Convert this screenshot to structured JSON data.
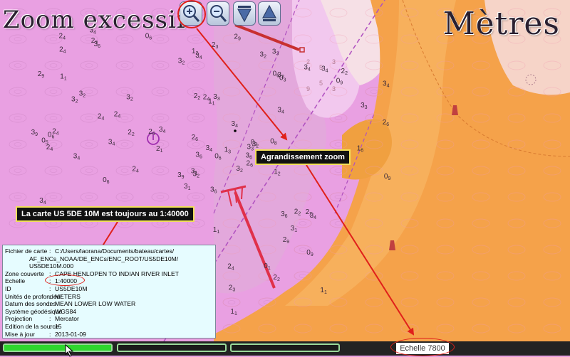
{
  "overlay": {
    "zoom_warning": "Zoom excessif",
    "units_label": "Mètres"
  },
  "toolbar": {
    "zoom_in_icon": "zoom-in-magnifier-icon",
    "zoom_out_icon": "zoom-out-magnifier-icon",
    "down_icon": "down-triangle-icon",
    "up_icon": "up-triangle-icon"
  },
  "callouts": {
    "zoom": "Agrandissement zoom",
    "scale": "La carte US 5DE 10M est toujours au 1:40000"
  },
  "chart_info": {
    "file_key": "Fichier de carte",
    "file_val": "C:/Users/laorana/Documents/bateau/cartes/",
    "file_cont1": "AF_ENCs_NOAA/DE_ENCs/ENC_ROOT/US5DE10M/",
    "file_cont2": "US5DE10M.000",
    "rows": [
      {
        "key": "Zone couverte",
        "val": "CAPE HENLOPEN TO INDIAN RIVER INLET"
      },
      {
        "key": "Echelle",
        "val": "1:40000"
      },
      {
        "key": "ID",
        "val": "US5DE10M"
      },
      {
        "key": "Unités de profondeur",
        "val": "METERS"
      },
      {
        "key": "Datum des sondes",
        "val": "MEAN LOWER LOW WATER"
      },
      {
        "key": "Système géodésique",
        "val": "WGS84"
      },
      {
        "key": "Projection",
        "val": "Mercator"
      },
      {
        "key": "Edition de la source",
        "val": "15"
      },
      {
        "key": "Mise à jour",
        "val": "2013-01-09"
      }
    ]
  },
  "map": {
    "soundings": [
      "3",
      "3",
      "3",
      "3",
      "3",
      "3",
      "3",
      "3",
      "3",
      "3",
      "3",
      "3",
      "3",
      "2",
      "3",
      "3",
      "2",
      "3",
      "3",
      "3",
      "3",
      "2",
      "3",
      "2",
      "3",
      "3",
      "3",
      "3",
      "2",
      "2",
      "2",
      "3",
      "2",
      "3",
      "3",
      "2",
      "3",
      "2",
      "3",
      "2",
      "2",
      "2",
      "2",
      "2",
      "2",
      "2",
      "2",
      "2",
      "3",
      "3",
      "3",
      "3",
      "3",
      "2",
      "2",
      "2",
      "2",
      "3",
      "2",
      "2",
      "1",
      "1",
      "1",
      "1",
      "1",
      "1",
      "0",
      "1",
      "0",
      "0",
      "0",
      "0",
      "0",
      "0",
      "0",
      "0",
      "0",
      "0",
      "0",
      "0",
      "0",
      "2",
      "1",
      "1",
      "3"
    ],
    "sounding_subs": [
      "6",
      "2",
      "2",
      "3",
      "3",
      "3",
      "2",
      "2",
      "6",
      "4",
      "4",
      "1",
      "4",
      "2",
      "4",
      "4",
      "4",
      "2",
      "4",
      "2",
      "4",
      "4",
      "6",
      "6",
      "1",
      "6",
      "2",
      "4",
      "2",
      "9",
      "6",
      "4",
      "9",
      "9",
      "6",
      "6",
      "3",
      "9",
      "1",
      "2",
      "3",
      "4",
      "4",
      "2",
      "3",
      "4",
      "4",
      "4",
      "4",
      "4",
      "2",
      "2",
      "4",
      "2",
      "2",
      "4",
      "4",
      "4",
      "6",
      "3",
      "3",
      "2",
      "6",
      "1",
      "1",
      "1",
      "1",
      "2",
      "8",
      "9",
      "6",
      "6",
      "6",
      "3",
      "6",
      "6",
      "9",
      "5",
      "9",
      "3",
      "9",
      "1",
      "1",
      "1",
      "9"
    ],
    "shoal_soundings": [
      "2",
      "5",
      "3",
      "9",
      "5",
      "3"
    ]
  },
  "status": {
    "progress_1": 1.0,
    "progress_2": 0.0,
    "progress_3": 0.0,
    "scale_readout": "Echelle 7800"
  },
  "colors": {
    "deep_magenta": "#ec98e6",
    "mid_magenta": "#e1a2d8",
    "shallow_pink": "#f0c8f0",
    "land_orange": "#f8a850",
    "dry_orange": "#f0a040",
    "light_land": "#f4d0c4",
    "annotation_red": "#e0201a",
    "progress_green": "#2fd52f"
  }
}
